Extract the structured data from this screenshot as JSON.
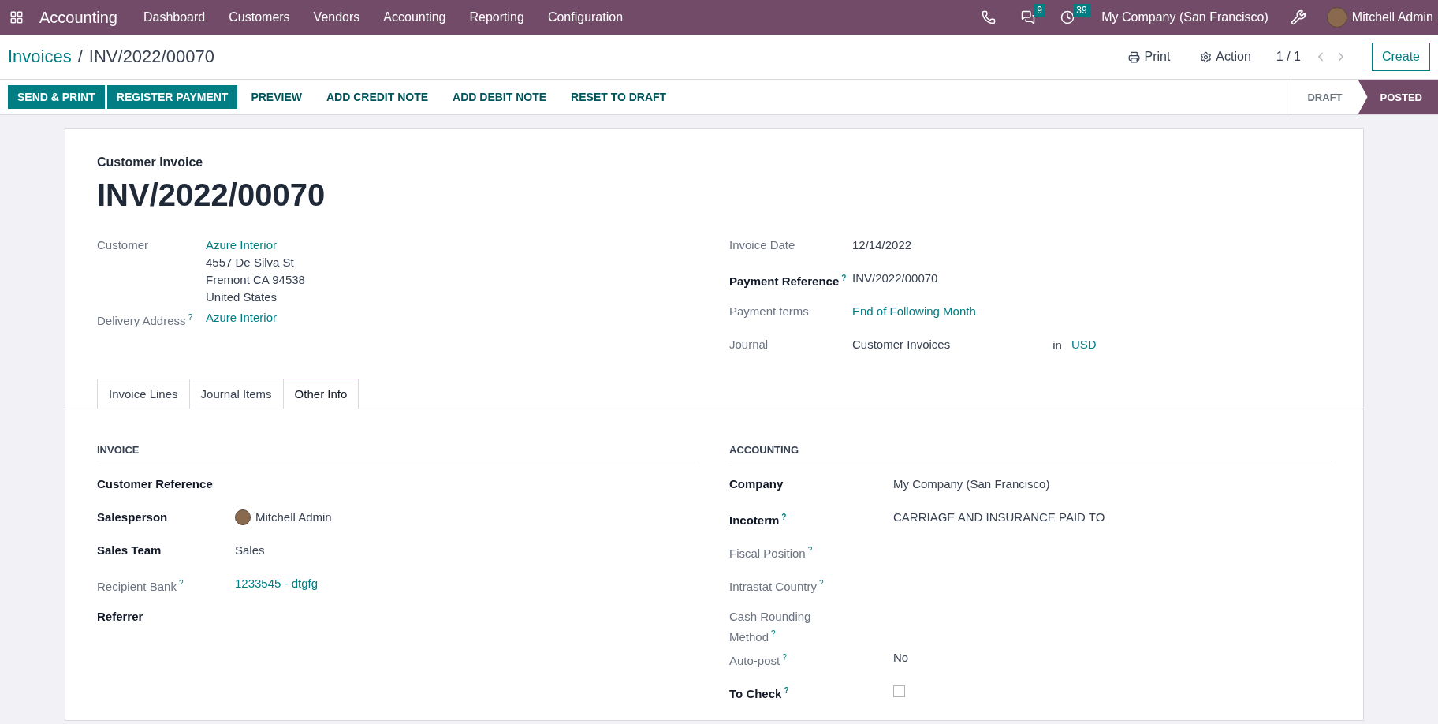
{
  "navbar": {
    "app_name": "Accounting",
    "menu": [
      "Dashboard",
      "Customers",
      "Vendors",
      "Accounting",
      "Reporting",
      "Configuration"
    ],
    "messages_badge": "9",
    "activities_badge": "39",
    "company": "My Company (San Francisco)",
    "user": "Mitchell Admin"
  },
  "breadcrumb": {
    "parent": "Invoices",
    "separator": "/",
    "current": "INV/2022/00070"
  },
  "control_actions": {
    "print": "Print",
    "action": "Action",
    "pager": "1 / 1",
    "create": "Create"
  },
  "action_buttons": [
    {
      "label": "SEND & PRINT",
      "kind": "primary"
    },
    {
      "label": "REGISTER PAYMENT",
      "kind": "primary"
    },
    {
      "label": "PREVIEW",
      "kind": "link"
    },
    {
      "label": "ADD CREDIT NOTE",
      "kind": "link"
    },
    {
      "label": "ADD DEBIT NOTE",
      "kind": "link"
    },
    {
      "label": "RESET TO DRAFT",
      "kind": "link"
    }
  ],
  "status_stages": [
    {
      "label": "DRAFT",
      "selected": false
    },
    {
      "label": "POSTED",
      "selected": true
    }
  ],
  "form": {
    "type_label": "Customer Invoice",
    "number": "INV/2022/00070",
    "left_fields": [
      {
        "label": "Customer",
        "bold": false,
        "kind": "link",
        "value": "Azure Interior",
        "lines": [
          "4557 De Silva St",
          "Fremont CA 94538",
          "United States"
        ]
      },
      {
        "label": "Delivery Address",
        "bold": false,
        "help": "?",
        "kind": "link",
        "value": "Azure Interior"
      }
    ],
    "right_fields": [
      {
        "label": "Invoice Date",
        "bold": false,
        "kind": "text",
        "value": "12/14/2022"
      },
      {
        "label": "Payment Reference",
        "bold": true,
        "help": "?",
        "kind": "text",
        "value": "INV/2022/00070"
      },
      {
        "label": "Payment terms",
        "bold": false,
        "kind": "link",
        "value": "End of Following Month"
      },
      {
        "label": "Journal",
        "bold": false,
        "kind": "journal",
        "value": "Customer Invoices",
        "connector": "in",
        "currency": "USD"
      }
    ]
  },
  "tabs": [
    {
      "label": "Invoice Lines",
      "selected": false
    },
    {
      "label": "Journal Items",
      "selected": false
    },
    {
      "label": "Other Info",
      "selected": true
    }
  ],
  "other_info": {
    "sections": [
      {
        "title": "INVOICE",
        "fields": [
          {
            "label": "Customer Reference",
            "bold": true,
            "kind": "empty"
          },
          {
            "label": "Salesperson",
            "bold": true,
            "kind": "avatar",
            "value": "Mitchell Admin"
          },
          {
            "label": "Sales Team",
            "bold": true,
            "kind": "text",
            "value": "Sales"
          },
          {
            "label": "Recipient Bank",
            "bold": false,
            "help": "?",
            "kind": "link",
            "value": "1233545 - dtgfg"
          },
          {
            "label": "Referrer",
            "bold": true,
            "kind": "empty"
          }
        ]
      },
      {
        "title": "ACCOUNTING",
        "fields": [
          {
            "label": "Company",
            "bold": true,
            "kind": "text",
            "value": "My Company (San Francisco)"
          },
          {
            "label": "Incoterm",
            "bold": true,
            "help": "?",
            "kind": "text",
            "value": "CARRIAGE AND INSURANCE PAID TO"
          },
          {
            "label": "Fiscal Position",
            "bold": false,
            "help": "?",
            "kind": "empty"
          },
          {
            "label": "Intrastat Country",
            "bold": false,
            "help": "?",
            "kind": "empty"
          },
          {
            "label": "Cash Rounding Method",
            "bold": false,
            "help": "?",
            "kind": "empty"
          },
          {
            "label": "Auto-post",
            "bold": false,
            "help": "?",
            "kind": "text",
            "value": "No"
          },
          {
            "label": "To Check",
            "bold": true,
            "help": "?",
            "kind": "checkbox",
            "checked": false
          }
        ]
      }
    ]
  }
}
